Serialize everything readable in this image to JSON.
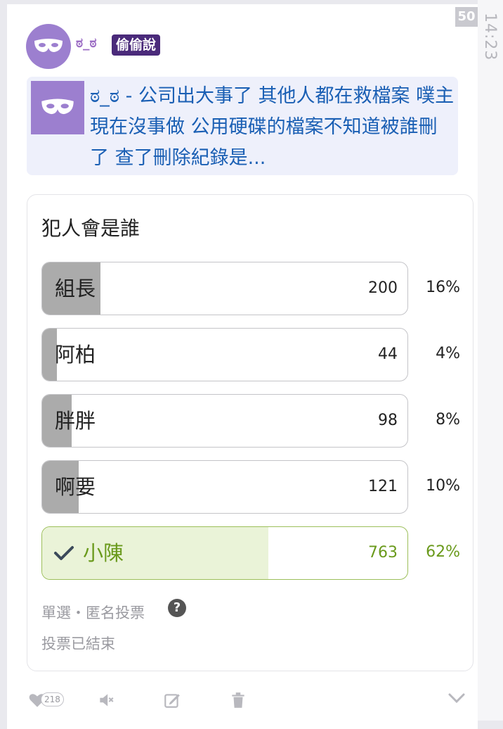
{
  "post": {
    "username": "ಠ_ಠ",
    "tag": "偷偷說",
    "time": "14:23",
    "badge_count": "50"
  },
  "quote": {
    "text": "ಠ_ಠ - 公司出大事了 其他人都在救檔案 噗主現在沒事做 公用硬碟的檔案不知道被誰刪了 查了刪除紀錄是..."
  },
  "poll": {
    "title": "犯人會是誰",
    "options": [
      {
        "label": "組長",
        "count": "200",
        "percent": "16%",
        "fraction": 0.16,
        "selected": false
      },
      {
        "label": "阿柏",
        "count": "44",
        "percent": "4%",
        "fraction": 0.04,
        "selected": false
      },
      {
        "label": "胖胖",
        "count": "98",
        "percent": "8%",
        "fraction": 0.08,
        "selected": false
      },
      {
        "label": "啊要",
        "count": "121",
        "percent": "10%",
        "fraction": 0.1,
        "selected": false
      },
      {
        "label": "小陳",
        "count": "763",
        "percent": "62%",
        "fraction": 0.62,
        "selected": true
      }
    ],
    "meta_type": "單選・匿名投票",
    "help_icon": "?",
    "status": "投票已結束"
  },
  "actions": {
    "like_count": "218",
    "icons": [
      "heart-icon",
      "mute-icon",
      "edit-icon",
      "trash-icon",
      "chevron-down-icon"
    ]
  },
  "colors": {
    "accent_purple": "#4a2a7a",
    "link_blue": "#1a5fb4",
    "selected_green": "#6a9a1c"
  }
}
